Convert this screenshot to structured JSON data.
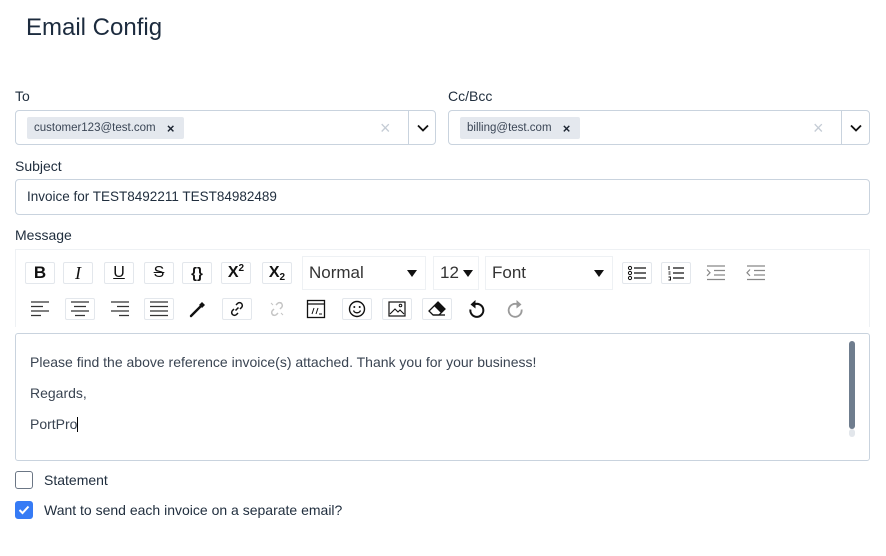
{
  "page": {
    "title": "Email Config"
  },
  "to": {
    "label": "To",
    "chips": [
      "customer123@test.com"
    ],
    "chip_remove": "×",
    "clear": "×"
  },
  "cc": {
    "label": "Cc/Bcc",
    "chips": [
      "billing@test.com"
    ],
    "chip_remove": "×",
    "clear": "×"
  },
  "subject": {
    "label": "Subject",
    "value": "Invoice for TEST8492211 TEST84982489"
  },
  "message": {
    "label": "Message",
    "toolbar": {
      "bold": "B",
      "italic": "I",
      "underline": "U",
      "strike": "S",
      "code": "{}",
      "superscript_base": "X",
      "superscript_mark": "2",
      "subscript_base": "X",
      "subscript_mark": "2",
      "heading": "Normal",
      "size": "12",
      "font": "Font"
    },
    "lines": [
      "Please find the above reference invoice(s) attached. Thank you for your business!",
      "Regards,",
      "PortPro"
    ]
  },
  "options": {
    "statement_label": "Statement",
    "statement_checked": false,
    "separate_label": "Want to send each invoice on a separate email?",
    "separate_checked": true
  },
  "colors": {
    "accent": "#367bf5",
    "border": "#c9d3de",
    "chip_bg": "#e4e8ee"
  }
}
